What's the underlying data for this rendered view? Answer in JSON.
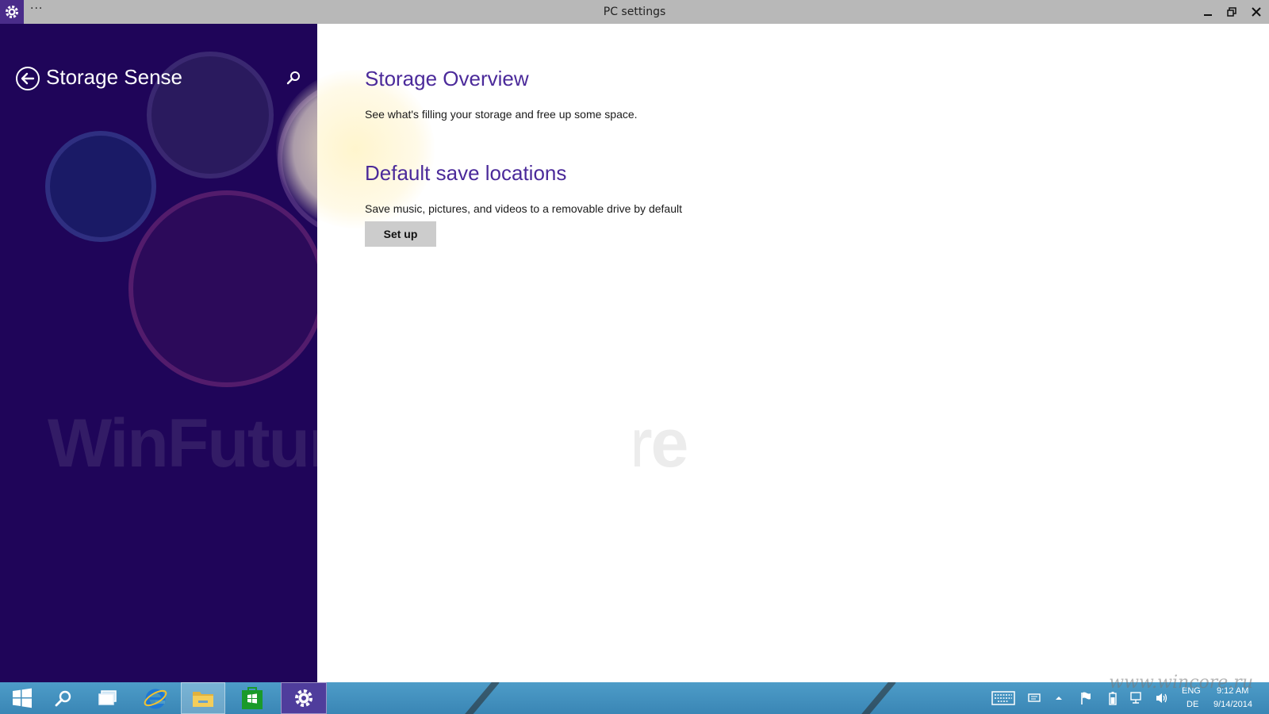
{
  "window": {
    "title": "PC settings",
    "ellipsis": "···"
  },
  "left": {
    "title": "Storage Sense",
    "watermark": "WinFuture",
    "colors": {
      "background": "#1f0559"
    }
  },
  "content": {
    "sections": [
      {
        "title": "Storage Overview",
        "description": "See what's filling your storage and free up some space."
      },
      {
        "title": "Default save locations",
        "description": "Save music, pictures, and videos to a removable drive by default",
        "button": "Set up"
      }
    ],
    "colors": {
      "heading": "#4b2a9a"
    }
  },
  "taskbar": {
    "items": [
      {
        "name": "start-icon"
      },
      {
        "name": "search-icon"
      },
      {
        "name": "task-view-icon"
      },
      {
        "name": "internet-explorer-icon"
      },
      {
        "name": "file-explorer-icon"
      },
      {
        "name": "store-icon"
      },
      {
        "name": "settings-icon"
      }
    ],
    "tray": {
      "language_top": "ENG",
      "language_bottom": "DE",
      "time": "9:12 AM",
      "date": "9/14/2014"
    },
    "watermark": "www.wincore.ru"
  }
}
